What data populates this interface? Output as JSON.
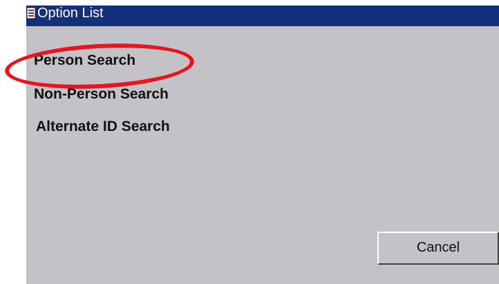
{
  "window": {
    "title": "Option List",
    "title_icon": "application-icon",
    "titlebar_color": "#14307c",
    "background_color": "#c4c2c6"
  },
  "options": [
    {
      "label": "Person Search",
      "highlighted": true
    },
    {
      "label": "Non-Person Search",
      "highlighted": false
    },
    {
      "label": "Alternate ID Search",
      "highlighted": false
    }
  ],
  "annotation": {
    "shape": "ellipse",
    "color": "#e8141e",
    "target": "Person Search"
  },
  "buttons": {
    "cancel_label": "Cancel"
  }
}
